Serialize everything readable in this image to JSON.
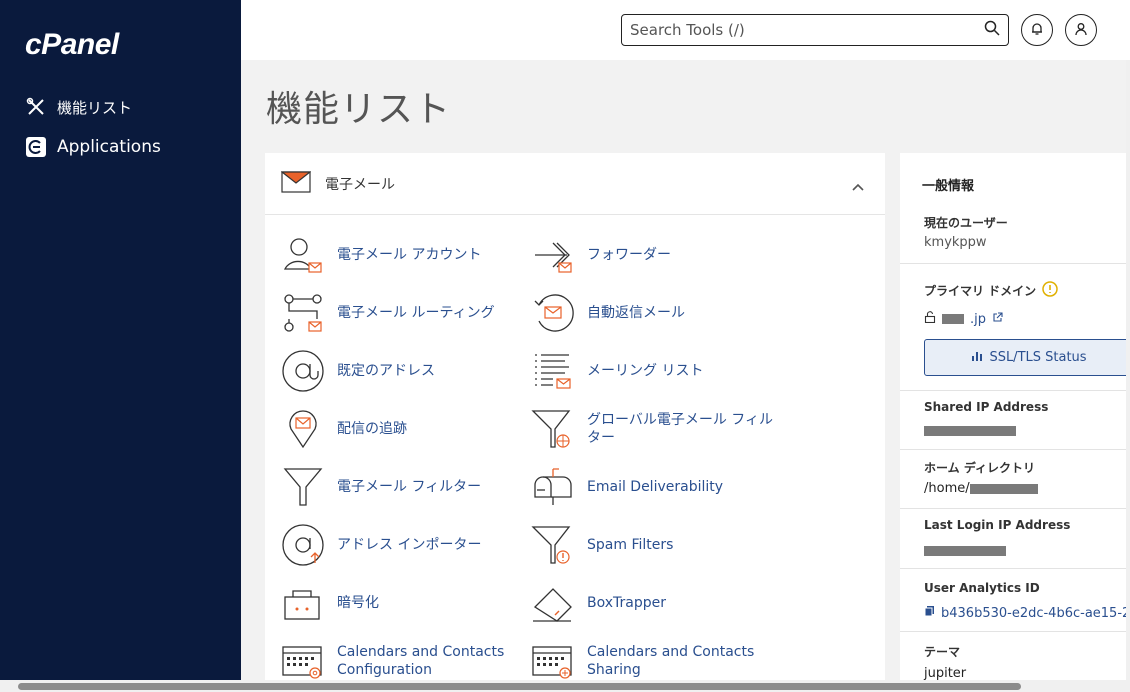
{
  "sidebar": {
    "logo": "cPanel",
    "items": [
      {
        "label": "機能リスト",
        "icon": "tools-icon"
      },
      {
        "label": "Applications",
        "icon": "applications-icon"
      }
    ]
  },
  "header": {
    "search_placeholder": "Search Tools (/)",
    "icons": [
      "search-icon",
      "bell-icon",
      "user-icon"
    ]
  },
  "page": {
    "title": "機能リスト"
  },
  "email_panel": {
    "title": "電子メール",
    "tools": [
      {
        "label": "電子メール アカウント",
        "icon": "email-accounts-icon"
      },
      {
        "label": "フォワーダー",
        "icon": "forwarders-icon"
      },
      {
        "label": "電子メール ルーティング",
        "icon": "email-routing-icon"
      },
      {
        "label": "自動返信メール",
        "icon": "autoresponders-icon"
      },
      {
        "label": "既定のアドレス",
        "icon": "default-address-icon"
      },
      {
        "label": "メーリング リスト",
        "icon": "mailing-lists-icon"
      },
      {
        "label": "配信の追跡",
        "icon": "track-delivery-icon"
      },
      {
        "label": "グローバル電子メール フィルター",
        "icon": "global-email-filters-icon"
      },
      {
        "label": "電子メール フィルター",
        "icon": "email-filters-icon"
      },
      {
        "label": "Email Deliverability",
        "icon": "email-deliverability-icon"
      },
      {
        "label": "アドレス インポーター",
        "icon": "address-importer-icon"
      },
      {
        "label": "Spam Filters",
        "icon": "spam-filters-icon"
      },
      {
        "label": "暗号化",
        "icon": "encryption-icon"
      },
      {
        "label": "BoxTrapper",
        "icon": "boxtrapper-icon"
      },
      {
        "label": "Calendars and Contacts Configuration",
        "icon": "calendars-config-icon"
      },
      {
        "label": "Calendars and Contacts Sharing",
        "icon": "calendars-sharing-icon"
      }
    ]
  },
  "general_info": {
    "title": "一般情報",
    "current_user_label": "現在のユーザー",
    "current_user_value": "kmykppw",
    "primary_domain_label": "プライマリ ドメイン",
    "primary_domain_value": ".jp",
    "ssl_button": "SSL/TLS Status",
    "shared_ip_label": "Shared IP Address",
    "home_dir_label": "ホーム ディレクトリ",
    "home_dir_value": "/home/",
    "last_login_label": "Last Login IP Address",
    "analytics_label": "User Analytics ID",
    "analytics_value": "b436b530-e2dc-4b6c-ae15-2",
    "theme_label": "テーマ",
    "theme_value": "jupiter"
  },
  "colors": {
    "sidebar": "#0a1a3d",
    "accent": "#e8622a",
    "link": "#2a4f8f"
  }
}
